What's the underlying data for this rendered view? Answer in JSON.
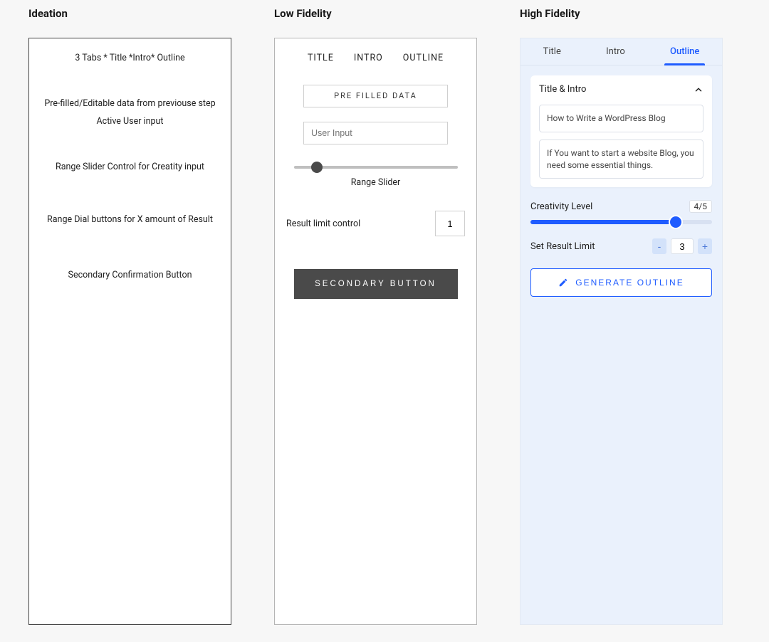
{
  "ideation": {
    "title": "Ideation",
    "lines": {
      "tabs": "3 Tabs * Title *Intro* Outline",
      "prefill": "Pre-filled/Editable data from previouse step",
      "active": "Active User input",
      "slider": "Range Slider Control for Creatity input",
      "dial": "Range Dial buttons for X amount of Result",
      "button": "Secondary Confirmation Button"
    }
  },
  "lofi": {
    "title": "Low Fidelity",
    "tabs": [
      "TITLE",
      "INTRO",
      "OUTLINE"
    ],
    "prefill_label": "PRE FILLED DATA",
    "user_input_placeholder": "User Input",
    "slider_label": "Range Slider",
    "result_label": "Result limit control",
    "result_value": "1",
    "button_label": "SECONDARY BUTTON"
  },
  "hifi": {
    "title": "High Fidelity",
    "tabs": [
      "Title",
      "Intro",
      "Outline"
    ],
    "active_tab": "Outline",
    "card_title": "Title & Intro",
    "prefill_text": "How to Write a WordPress Blog",
    "intro_text": "If You want to start a website Blog, you need some essential things.",
    "creativity_label": "Creativity Level",
    "creativity_value": "4/5",
    "result_limit_label": "Set Result Limit",
    "result_limit_value": "3",
    "stepper_minus": "-",
    "stepper_plus": "+",
    "button_label": "GENERATE OUTLINE"
  }
}
